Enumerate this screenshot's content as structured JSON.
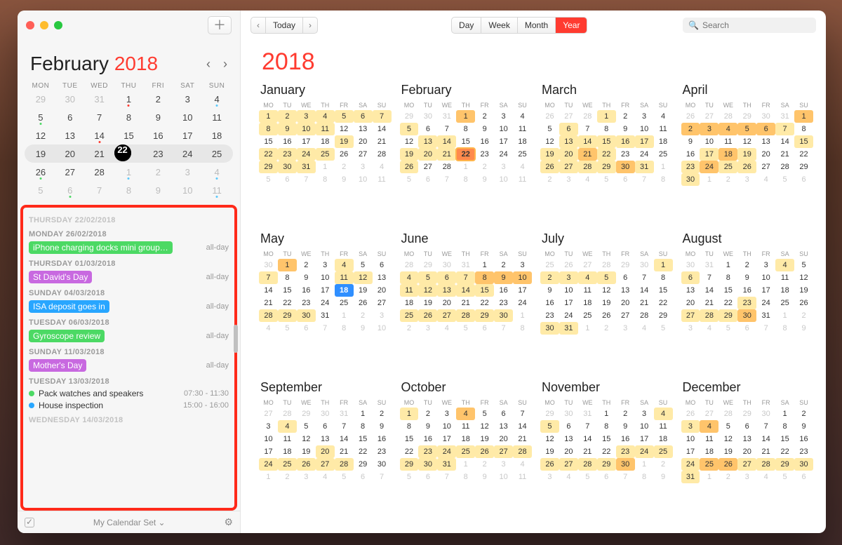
{
  "sidebar": {
    "month": "February",
    "year": "2018",
    "dow": [
      "MON",
      "TUE",
      "WED",
      "THU",
      "FRI",
      "SAT",
      "SUN"
    ],
    "mini_weeks": [
      [
        {
          "d": "29",
          "cls": "out"
        },
        {
          "d": "30",
          "cls": "out"
        },
        {
          "d": "31",
          "cls": "out"
        },
        {
          "d": "1",
          "cls": "dot red"
        },
        {
          "d": "2",
          "cls": ""
        },
        {
          "d": "3",
          "cls": ""
        },
        {
          "d": "4",
          "cls": "dot"
        }
      ],
      [
        {
          "d": "5",
          "cls": "dot green"
        },
        {
          "d": "6",
          "cls": ""
        },
        {
          "d": "7",
          "cls": ""
        },
        {
          "d": "8",
          "cls": ""
        },
        {
          "d": "9",
          "cls": ""
        },
        {
          "d": "10",
          "cls": ""
        },
        {
          "d": "11",
          "cls": ""
        }
      ],
      [
        {
          "d": "12",
          "cls": ""
        },
        {
          "d": "13",
          "cls": ""
        },
        {
          "d": "14",
          "cls": "dot red"
        },
        {
          "d": "15",
          "cls": ""
        },
        {
          "d": "16",
          "cls": ""
        },
        {
          "d": "17",
          "cls": ""
        },
        {
          "d": "18",
          "cls": ""
        }
      ],
      [
        {
          "d": "19",
          "cls": ""
        },
        {
          "d": "20",
          "cls": ""
        },
        {
          "d": "21",
          "cls": ""
        },
        {
          "d": "22",
          "cls": "today"
        },
        {
          "d": "23",
          "cls": ""
        },
        {
          "d": "24",
          "cls": ""
        },
        {
          "d": "25",
          "cls": ""
        }
      ],
      [
        {
          "d": "26",
          "cls": "dot green"
        },
        {
          "d": "27",
          "cls": ""
        },
        {
          "d": "28",
          "cls": ""
        },
        {
          "d": "1",
          "cls": "out dot"
        },
        {
          "d": "2",
          "cls": "out"
        },
        {
          "d": "3",
          "cls": "out"
        },
        {
          "d": "4",
          "cls": "out dot"
        }
      ],
      [
        {
          "d": "5",
          "cls": "out"
        },
        {
          "d": "6",
          "cls": "out dot green"
        },
        {
          "d": "7",
          "cls": "out"
        },
        {
          "d": "8",
          "cls": "out"
        },
        {
          "d": "9",
          "cls": "out"
        },
        {
          "d": "10",
          "cls": "out"
        },
        {
          "d": "11",
          "cls": "out dot"
        }
      ]
    ],
    "pill_row": 3,
    "events": [
      {
        "date": "THURSDAY 22/02/2018",
        "dim": true,
        "items": []
      },
      {
        "date": "MONDAY 26/02/2018",
        "items": [
          {
            "type": "pill",
            "cls": "p-green",
            "text": "iPhone charging docks mini group…",
            "time": "all-day"
          }
        ]
      },
      {
        "date": "THURSDAY 01/03/2018",
        "items": [
          {
            "type": "pill",
            "cls": "p-purple",
            "text": "St David's Day",
            "time": "all-day"
          }
        ]
      },
      {
        "date": "SUNDAY 04/03/2018",
        "items": [
          {
            "type": "pill",
            "cls": "p-blue",
            "text": "ISA deposit goes in",
            "time": "all-day"
          }
        ]
      },
      {
        "date": "TUESDAY 06/03/2018",
        "items": [
          {
            "type": "pill",
            "cls": "p-green",
            "text": "Gyroscope review",
            "time": "all-day"
          }
        ]
      },
      {
        "date": "SUNDAY 11/03/2018",
        "items": [
          {
            "type": "pill",
            "cls": "p-purple",
            "text": "Mother's Day",
            "time": "all-day"
          }
        ]
      },
      {
        "date": "TUESDAY 13/03/2018",
        "items": [
          {
            "type": "dot",
            "cls": "d-green",
            "text": "Pack watches and speakers",
            "time": "07:30 - 11:30"
          },
          {
            "type": "dot",
            "cls": "d-blue",
            "text": "House inspection",
            "time": "15:00 - 16:00"
          }
        ]
      },
      {
        "date": "WEDNESDAY 14/03/2018",
        "dim": true,
        "items": []
      }
    ],
    "bottom_set": "My Calendar Set"
  },
  "toolbar": {
    "today": "Today",
    "views": [
      "Day",
      "Week",
      "Month",
      "Year"
    ],
    "active_view": "Year",
    "search_placeholder": "Search"
  },
  "main_year": "2018",
  "ydow": [
    "MO",
    "TU",
    "WE",
    "TH",
    "FR",
    "SA",
    "SU"
  ],
  "months": [
    {
      "name": "January",
      "start": 0,
      "days": 31,
      "prev": 31,
      "hl": {
        "1": 1,
        "2": 1,
        "3": 1,
        "4": 1,
        "5": 1,
        "6": 1,
        "7": 1,
        "8": 1,
        "9": 1,
        "10": 1,
        "11": 1,
        "19": 1,
        "22": 1,
        "23": 1,
        "24": 1,
        "25": 1,
        "29": 1,
        "30": 1,
        "31": 1
      }
    },
    {
      "name": "February",
      "start": 3,
      "days": 28,
      "prev": 31,
      "hl": {
        "1": 2,
        "5": 1,
        "13": 1,
        "14": 1,
        "19": 1,
        "20": 1,
        "21": 1,
        "26": 1
      },
      "today": 22
    },
    {
      "name": "March",
      "start": 3,
      "days": 31,
      "prev": 28,
      "hl": {
        "1": 1,
        "6": 1,
        "13": 1,
        "14": 1,
        "15": 1,
        "16": 1,
        "17": 1,
        "19": 1,
        "20": 1,
        "21": 2,
        "22": 1,
        "26": 1,
        "27": 1,
        "28": 1,
        "29": 1,
        "30": 2,
        "31": 1
      }
    },
    {
      "name": "April",
      "start": 6,
      "days": 30,
      "prev": 31,
      "hl": {
        "1": 2,
        "2": 2,
        "3": 2,
        "4": 2,
        "5": 2,
        "6": 2,
        "7": 1,
        "15": 1,
        "17": 1,
        "18": 2,
        "19": 1,
        "23": 1,
        "24": 2,
        "25": 1,
        "26": 1,
        "30": 1
      }
    },
    {
      "name": "May",
      "start": 1,
      "days": 31,
      "prev": 30,
      "hl": {
        "1": 2,
        "4": 1,
        "7": 1,
        "11": 1,
        "12": 1,
        "28": 1,
        "29": 1,
        "30": 1
      },
      "special": 18
    },
    {
      "name": "June",
      "start": 4,
      "days": 30,
      "prev": 31,
      "hl": {
        "4": 1,
        "5": 1,
        "6": 1,
        "7": 1,
        "8": 2,
        "9": 2,
        "10": 2,
        "11": 1,
        "12": 1,
        "13": 1,
        "14": 1,
        "15": 1,
        "25": 1,
        "26": 1,
        "27": 1,
        "28": 1,
        "29": 1,
        "30": 1
      }
    },
    {
      "name": "July",
      "start": 6,
      "days": 31,
      "prev": 30,
      "hl": {
        "1": 1,
        "2": 1,
        "3": 1,
        "4": 1,
        "5": 1,
        "30": 1,
        "31": 1
      }
    },
    {
      "name": "August",
      "start": 2,
      "days": 31,
      "prev": 31,
      "hl": {
        "4": 1,
        "6": 1,
        "23": 1,
        "27": 1,
        "28": 1,
        "29": 1,
        "30": 2
      }
    },
    {
      "name": "September",
      "start": 5,
      "days": 30,
      "prev": 31,
      "hl": {
        "4": 1,
        "20": 1,
        "24": 1,
        "25": 1,
        "26": 1,
        "27": 1,
        "28": 1
      }
    },
    {
      "name": "October",
      "start": 0,
      "days": 31,
      "prev": 30,
      "hl": {
        "1": 1,
        "4": 2,
        "23": 1,
        "24": 1,
        "25": 1,
        "26": 1,
        "27": 1,
        "28": 1,
        "29": 1,
        "30": 1,
        "31": 1
      }
    },
    {
      "name": "November",
      "start": 3,
      "days": 30,
      "prev": 31,
      "hl": {
        "4": 1,
        "5": 1,
        "23": 1,
        "24": 1,
        "25": 1,
        "26": 1,
        "27": 1,
        "28": 1,
        "29": 1,
        "30": 2
      }
    },
    {
      "name": "December",
      "start": 5,
      "days": 31,
      "prev": 30,
      "hl": {
        "3": 1,
        "4": 2,
        "24": 1,
        "25": 2,
        "26": 2,
        "27": 1,
        "28": 1,
        "29": 1,
        "30": 1,
        "31": 1
      }
    }
  ]
}
